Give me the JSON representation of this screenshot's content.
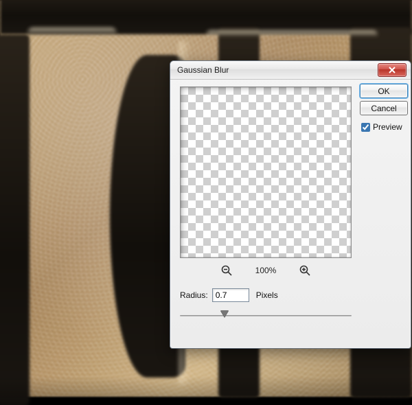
{
  "dialog": {
    "title": "Gaussian Blur",
    "close_icon": "close",
    "zoom_percent": "100%",
    "radius_label": "Radius:",
    "radius_value": "0.7",
    "radius_unit": "Pixels",
    "slider_min": 0.1,
    "slider_max": 250,
    "slider_value": 0.7,
    "buttons": {
      "ok": "OK",
      "cancel": "Cancel"
    },
    "preview_checkbox_label": "Preview",
    "preview_checked": true
  }
}
